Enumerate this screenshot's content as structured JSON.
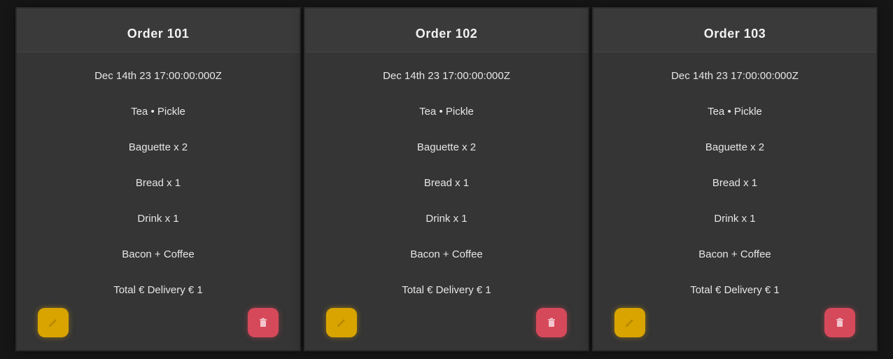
{
  "cards": [
    {
      "title": "Order 101",
      "rows": [
        "Dec 14th 23 17:00:00:000Z",
        "Tea • Pickle",
        "Baguette x 2",
        "Bread x 1",
        "Drink x 1",
        "Bacon + Coffee",
        "Total € Delivery € 1"
      ],
      "edit_icon": "edit-icon",
      "delete_icon": "trash-icon"
    },
    {
      "title": "Order 102",
      "rows": [
        "Dec 14th 23 17:00:00:000Z",
        "Tea • Pickle",
        "Baguette x 2",
        "Bread x 1",
        "Drink x 1",
        "Bacon + Coffee",
        "Total € Delivery € 1"
      ],
      "edit_icon": "edit-icon",
      "delete_icon": "trash-icon"
    },
    {
      "title": "Order 103",
      "rows": [
        "Dec 14th 23 17:00:00:000Z",
        "Tea • Pickle",
        "Baguette x 2",
        "Bread x 1",
        "Drink x 1",
        "Bacon + Coffee",
        "Total € Delivery € 1"
      ],
      "edit_icon": "edit-icon",
      "delete_icon": "trash-icon"
    }
  ],
  "colors": {
    "background": "#161616",
    "card": "#353535",
    "edit_button": "#d9a400",
    "delete_button": "#d6495a",
    "text": "#e6e6e6"
  }
}
